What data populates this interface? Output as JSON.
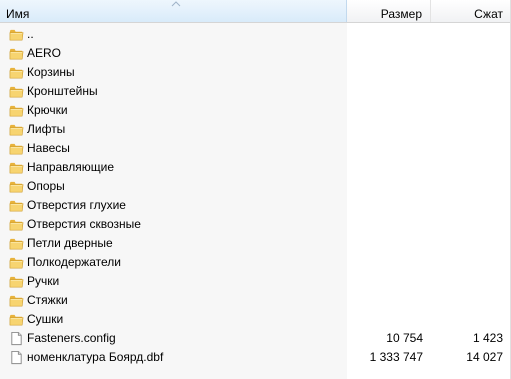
{
  "columns": {
    "name": "Имя",
    "size": "Размер",
    "packed": "Сжат"
  },
  "rows": [
    {
      "type": "folder",
      "icon": "folder-icon",
      "name": "..",
      "size": "",
      "packed": ""
    },
    {
      "type": "folder",
      "icon": "folder-icon",
      "name": "AERO",
      "size": "",
      "packed": ""
    },
    {
      "type": "folder",
      "icon": "folder-icon",
      "name": "Корзины",
      "size": "",
      "packed": ""
    },
    {
      "type": "folder",
      "icon": "folder-icon",
      "name": "Кронштейны",
      "size": "",
      "packed": ""
    },
    {
      "type": "folder",
      "icon": "folder-icon",
      "name": "Крючки",
      "size": "",
      "packed": ""
    },
    {
      "type": "folder",
      "icon": "folder-icon",
      "name": "Лифты",
      "size": "",
      "packed": ""
    },
    {
      "type": "folder",
      "icon": "folder-icon",
      "name": "Навесы",
      "size": "",
      "packed": ""
    },
    {
      "type": "folder",
      "icon": "folder-icon",
      "name": "Направляющие",
      "size": "",
      "packed": ""
    },
    {
      "type": "folder",
      "icon": "folder-icon",
      "name": "Опоры",
      "size": "",
      "packed": ""
    },
    {
      "type": "folder",
      "icon": "folder-icon",
      "name": "Отверстия глухие",
      "size": "",
      "packed": ""
    },
    {
      "type": "folder",
      "icon": "folder-icon",
      "name": "Отверстия сквозные",
      "size": "",
      "packed": ""
    },
    {
      "type": "folder",
      "icon": "folder-icon",
      "name": "Петли дверные",
      "size": "",
      "packed": ""
    },
    {
      "type": "folder",
      "icon": "folder-icon",
      "name": "Полкодержатели",
      "size": "",
      "packed": ""
    },
    {
      "type": "folder",
      "icon": "folder-icon",
      "name": "Ручки",
      "size": "",
      "packed": ""
    },
    {
      "type": "folder",
      "icon": "folder-icon",
      "name": "Стяжки",
      "size": "",
      "packed": ""
    },
    {
      "type": "folder",
      "icon": "folder-icon",
      "name": "Сушки",
      "size": "",
      "packed": ""
    },
    {
      "type": "file",
      "icon": "file-icon",
      "name": "Fasteners.config",
      "size": "10 754",
      "packed": "1 423"
    },
    {
      "type": "file",
      "icon": "file-icon",
      "name": "номенклатура Боярд.dbf",
      "size": "1 333 747",
      "packed": "14 027"
    }
  ]
}
